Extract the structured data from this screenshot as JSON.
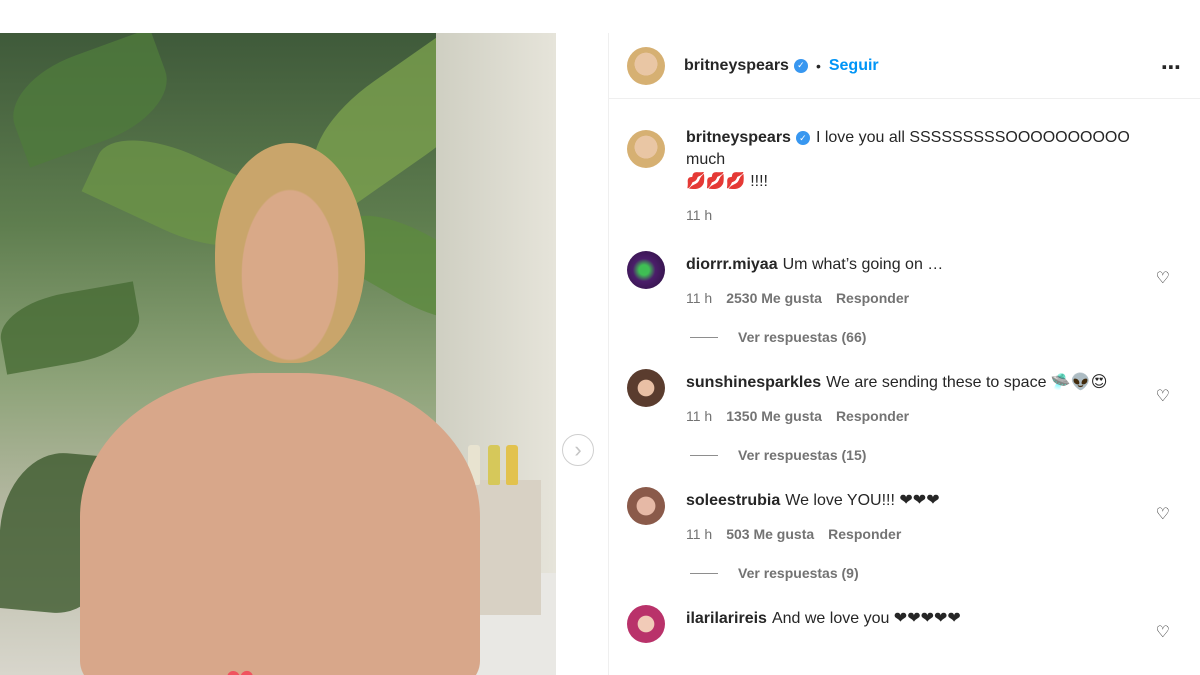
{
  "post": {
    "author": "britneyspears",
    "follow_label": "Seguir",
    "separator": "•",
    "more_icon": "⋯",
    "censor_icon": "♥",
    "next_icon": "›"
  },
  "caption": {
    "author": "britneyspears",
    "text": "I love you all SSSSSSSSSOOOOOOOOOO much",
    "emojis": "💋💋💋",
    "suffix": " !!!!",
    "time": "11 h"
  },
  "comments": [
    {
      "author": "diorrr.miyaa",
      "text": "Um what’s going on …",
      "time": "11 h",
      "likes": "2530 Me gusta",
      "reply_label": "Responder",
      "view_replies": "Ver respuestas (66)"
    },
    {
      "author": "sunshinesparkles",
      "text": "We are sending these to space 🛸👽😍",
      "time": "11 h",
      "likes": "1350 Me gusta",
      "reply_label": "Responder",
      "view_replies": "Ver respuestas (15)"
    },
    {
      "author": "soleestrubia",
      "text": "We love YOU!!! ❤❤❤",
      "time": "11 h",
      "likes": "503 Me gusta",
      "reply_label": "Responder",
      "view_replies": "Ver respuestas (9)"
    },
    {
      "author": "ilarilarireis",
      "text": "And we love you ❤❤❤❤❤"
    }
  ],
  "icons": {
    "verified": "✓",
    "heart_outline": "♡"
  }
}
